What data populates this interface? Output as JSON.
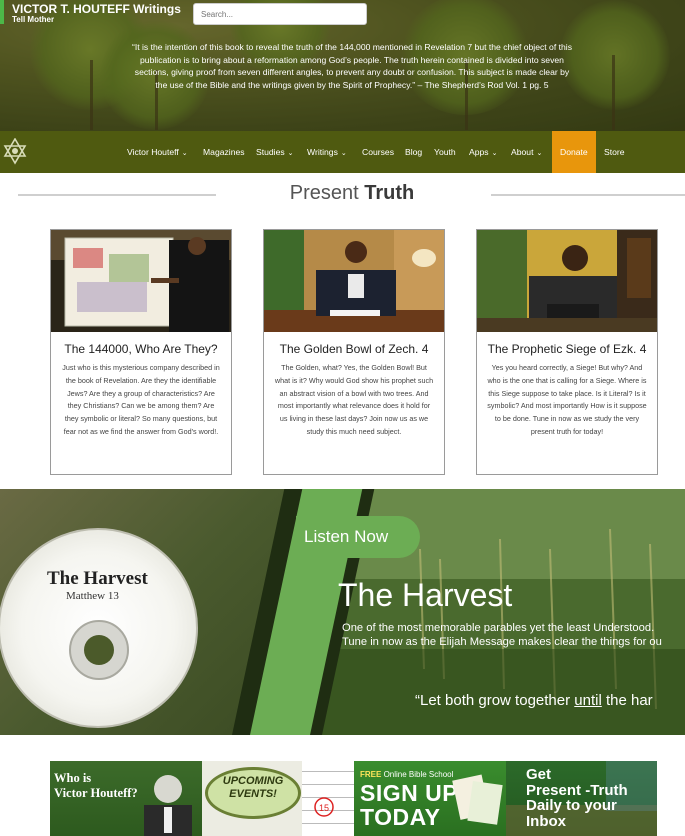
{
  "header": {
    "site_title": "VICTOR T. HOUTEFF Writings",
    "tagline": "Tell Mother",
    "search_placeholder": "Search...",
    "quote": "“It is the intention of this book to reveal the truth of the 144,000 mentioned in Revelation 7 but the chief object of this publication is to bring about a reformation among God’s people. The truth herein contained is divided into seven sections, giving proof from seven different angles, to prevent any doubt or confusion. This subject is made clear by the use of the Bible and the writings given by the Spirit of Prophecy.” – The Shepherd’s Rod Vol. 1 pg. 5"
  },
  "nav": {
    "items": [
      {
        "label": "Victor Houteff",
        "dropdown": true
      },
      {
        "label": "Magazines",
        "dropdown": false
      },
      {
        "label": "Studies",
        "dropdown": true
      },
      {
        "label": "Writings",
        "dropdown": true
      },
      {
        "label": "Courses",
        "dropdown": false
      },
      {
        "label": "Blog",
        "dropdown": false
      },
      {
        "label": "Youth",
        "dropdown": false
      },
      {
        "label": "Apps",
        "dropdown": true
      },
      {
        "label": "About",
        "dropdown": true
      },
      {
        "label": "Donate",
        "dropdown": false
      },
      {
        "label": "Store",
        "dropdown": false
      }
    ],
    "donate_color": "#e8960c",
    "bar_color": "#4f5a10"
  },
  "section": {
    "title_light": "Present ",
    "title_bold": "Truth"
  },
  "cards": [
    {
      "title": "The 144000, Who Are They?",
      "text": "Just who is this mysterious company described in the book of Revelation. Are they the identifiable Jews? Are they a group of characteristics? Are they Christians? Can we be among them? Are they symbolic or literal? So many questions, but fear not as we find the answer from God’s word!."
    },
    {
      "title": "The Golden Bowl of Zech. 4",
      "text": "The Golden, what? Yes, the Golden Bowl! But what is it? Why would God show his prophet such an abstract vision of a bowl with two trees. And most importantly what relevance does it hold for us living in these last days? Join now us as we study this much need subject."
    },
    {
      "title": "The Prophetic Siege of Ezk. 4",
      "text": "Yes you heard correctly, a Siege! But why? And who is the one that is calling for a Siege. Where is this Siege suppose to take place. Is it Literal? Is it symbolic? And most importantly How is it suppose to be done. Tune in now as we study the very present truth for today!"
    }
  ],
  "banner": {
    "cd_title": "The Harvest",
    "cd_subtitle": "Matthew 13",
    "listen_label": "Listen Now",
    "title": "The Harvest",
    "desc_line1": "One of the most memorable parables yet the least Understood.",
    "desc_line2": "Tune in now as the Elijah Message makes clear the things for ou",
    "quote_pre": "“Let both grow together ",
    "quote_underlined": "until",
    "quote_post": " the har",
    "accent_color": "#6cad54"
  },
  "promos": {
    "who_line1": "Who is",
    "who_line2": "Victor Houteff?",
    "events_line1": "UPCOMING",
    "events_line2": "EVENTS!",
    "free_label": "FREE",
    "school_label": " Online Bible School",
    "signup_line1": "SIGN UP",
    "signup_line2": "TODAY",
    "inbox_line1": "Get",
    "inbox_line2": "Present -Truth",
    "inbox_line3": "Daily to your",
    "inbox_line4": "Inbox"
  }
}
